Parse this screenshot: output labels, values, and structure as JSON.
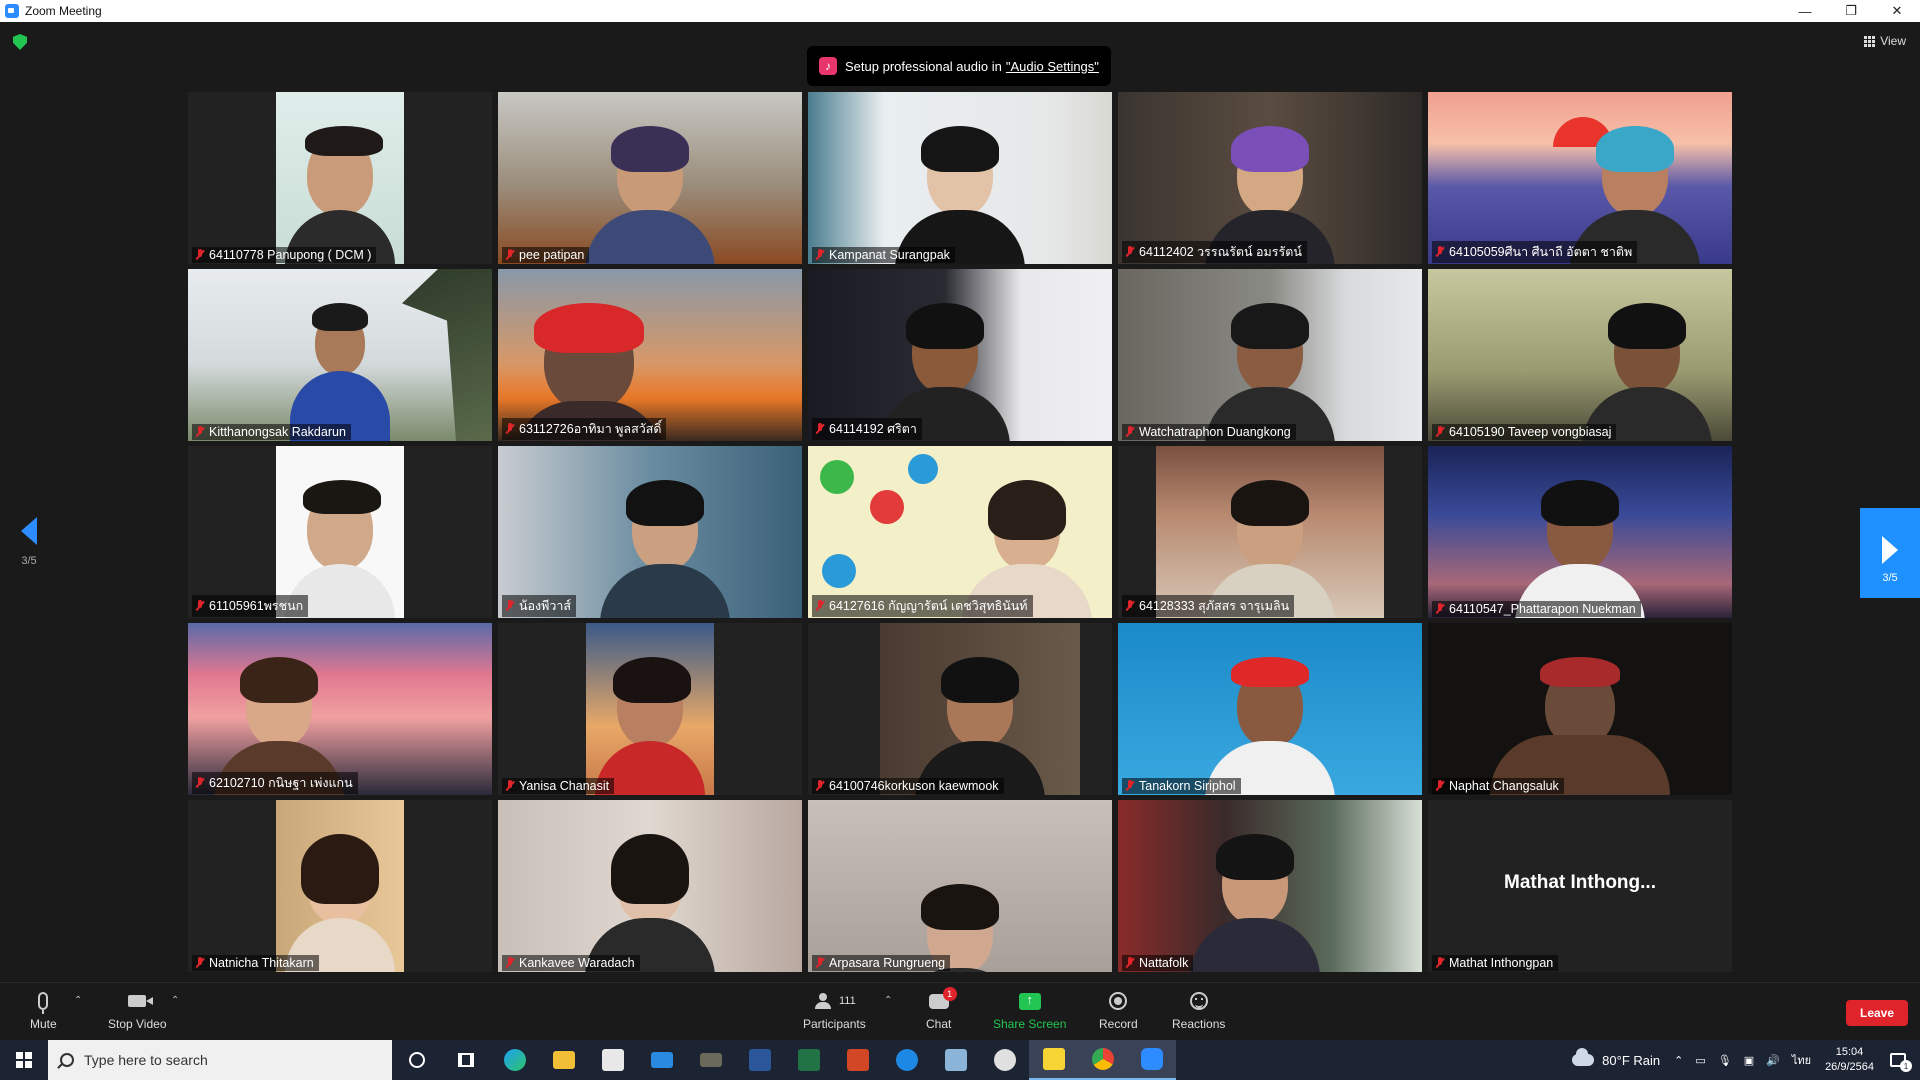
{
  "window": {
    "title": "Zoom Meeting"
  },
  "banner": {
    "text": "Setup professional audio in ",
    "link": "\"Audio Settings\""
  },
  "view": {
    "label": "View"
  },
  "pager": {
    "page": "3/5"
  },
  "participants": [
    {
      "name": "64110778  Panupong ( DCM )"
    },
    {
      "name": "pee patipan"
    },
    {
      "name": "Kampanat Surangpak"
    },
    {
      "name": "64112402 วรรณรัตน์ อมรรัตน์"
    },
    {
      "name": "64105059ศีนา ศีนาถี อัตตา ชาติพ"
    },
    {
      "name": "Kitthanongsak Rakdarun"
    },
    {
      "name": "63112726อาทิมา พูลสวัสดิ์"
    },
    {
      "name": "64114192 ศริตา"
    },
    {
      "name": "Watchatraphon Duangkong"
    },
    {
      "name": "64105190  Taveep vongbiasaj"
    },
    {
      "name": "61105961พรชนก"
    },
    {
      "name": "น้องพีวาส์"
    },
    {
      "name": "64127616 กัญญารัตน์ เดชวิสุทธินันท์"
    },
    {
      "name": "64128333 สุภัสสร จารุเมลิน"
    },
    {
      "name": "64110547_Phattarapon Nuekman"
    },
    {
      "name": "62102710 กนิษฐา เพ่งแกน"
    },
    {
      "name": "Yanisa Chanasit"
    },
    {
      "name": "64100746korkuson kaewmook"
    },
    {
      "name": "Tanakorn Siriphol"
    },
    {
      "name": "Naphat Changsaluk"
    },
    {
      "name": "Natnicha Thitakarn"
    },
    {
      "name": "Kankavee Waradach"
    },
    {
      "name": "Arpasara Rungrueng"
    },
    {
      "name": "Nattafolk"
    },
    {
      "name": "Mathat Inthongpan",
      "display": "Mathat  Inthong..."
    }
  ],
  "toolbar": {
    "mute": "Mute",
    "stop_video": "Stop Video",
    "participants": "Participants",
    "participant_count": "111",
    "chat": "Chat",
    "chat_badge": "1",
    "share_screen": "Share Screen",
    "record": "Record",
    "reactions": "Reactions",
    "leave": "Leave"
  },
  "taskbar": {
    "search_placeholder": "Type here to search",
    "weather": "80°F  Rain",
    "lang": "ไทย",
    "time": "15:04",
    "date": "26/9/2564",
    "notif_count": "1"
  },
  "colors": {
    "accent": "#2d8cff",
    "share_green": "#23c552",
    "leave_red": "#e0242b",
    "muted_red": "#e0242b"
  }
}
